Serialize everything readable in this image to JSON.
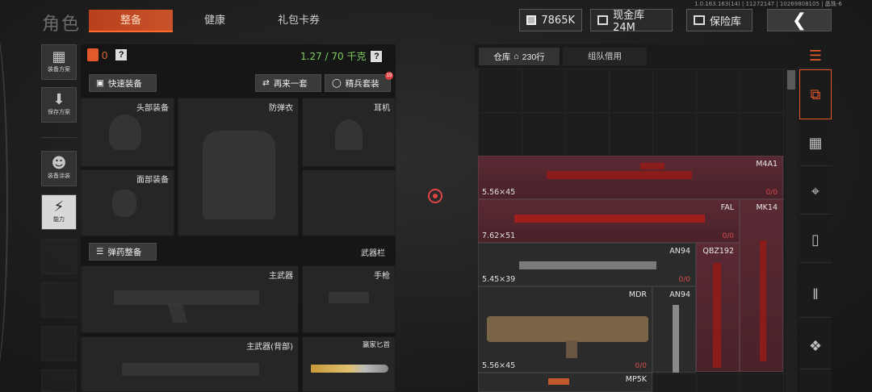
{
  "version": "1.0.163.163(14) | 11272147 | 10269808105 | 晶珠-6",
  "header": {
    "title": "角色",
    "tabs": [
      {
        "label": "整备",
        "active": true
      },
      {
        "label": "健康",
        "active": false
      },
      {
        "label": "礼包卡券",
        "active": false
      }
    ],
    "currency_silver": "7865K",
    "cash_vault": "现金库 24M",
    "safe_label": "保险库",
    "back_icon": "chevron-left-icon"
  },
  "sidebar": {
    "items": [
      {
        "label": "装备方案",
        "icon": "vest-icon"
      },
      {
        "label": "保存方案",
        "icon": "download-icon"
      },
      {
        "label": "装备涂装",
        "icon": "mask-icon"
      },
      {
        "label": "能力",
        "icon": "ability-icon"
      }
    ]
  },
  "loadout": {
    "armor_count": "0",
    "help": "?",
    "weight": "1.27 / 70 千克",
    "quick_equip": "快速装备",
    "again": "再来一套",
    "elite_set": "精兵套装",
    "elite_badge": "19",
    "slots": {
      "head": "头部装备",
      "vest": "防弹衣",
      "earphone": "耳机",
      "face": "面部装备"
    },
    "ammo_btn": "弹药整备",
    "weapon_bar": "武器栏",
    "weapon_slots": {
      "primary": "主武器",
      "pistol": "手枪",
      "primary_back": "主武器(背部)",
      "knife": "赢家匕首"
    }
  },
  "warehouse": {
    "tab_label": "仓库",
    "rows": "230行",
    "team_borrow": "组队借用",
    "items": [
      {
        "name": "M4A1",
        "caliber": "5.56×45",
        "count": "0/0"
      },
      {
        "name": "FAL",
        "caliber": "7.62×51",
        "count": "0/0"
      },
      {
        "name": "MK14",
        "caliber": "",
        "count": ""
      },
      {
        "name": "AN94",
        "caliber": "5.45×39",
        "count": "0/0"
      },
      {
        "name": "QBZ192",
        "caliber": "",
        "count": ""
      },
      {
        "name": "MDR",
        "caliber": "5.56×45",
        "count": "0/0"
      },
      {
        "name": "AN94",
        "caliber": "",
        "count": ""
      },
      {
        "name": "MP5K",
        "caliber": "",
        "count": ""
      }
    ]
  },
  "colors": {
    "accent": "#c8532a",
    "weight_green": "#7cd05a",
    "item_red": "#5a2a33",
    "count_red": "#d34c4c"
  }
}
